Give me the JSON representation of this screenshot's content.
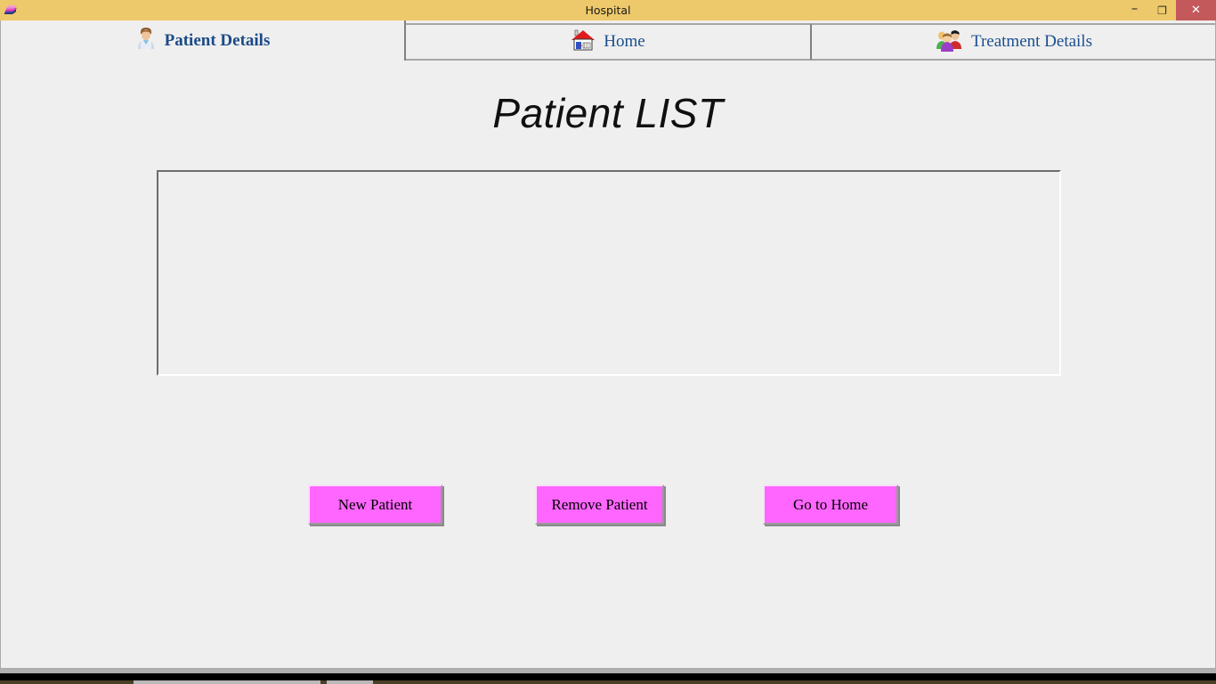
{
  "window": {
    "title": "Hospital",
    "icon": "books-icon",
    "controls": {
      "minimize": "–",
      "maximize": "❐",
      "close": "✕"
    },
    "colors": {
      "titlebar": "#eec96b",
      "close_button": "#c4595b",
      "body": "#efefef",
      "button_pink": "#ff66ff",
      "tab_text_blue": "#1b4f8f"
    }
  },
  "tabs": [
    {
      "label": "Patient Details",
      "icon": "user-icon",
      "active": true
    },
    {
      "label": "Home",
      "icon": "house-icon",
      "active": false
    },
    {
      "label": "Treatment Details",
      "icon": "people-group-icon",
      "active": false
    }
  ],
  "main": {
    "heading": "Patient LIST",
    "list": {
      "name": "patient-list",
      "items": [],
      "empty": ""
    },
    "buttons": [
      {
        "label": "New Patient",
        "name": "new-patient-button"
      },
      {
        "label": "Remove Patient",
        "name": "remove-patient-button"
      },
      {
        "label": "Go to Home",
        "name": "go-to-home-button"
      }
    ]
  }
}
